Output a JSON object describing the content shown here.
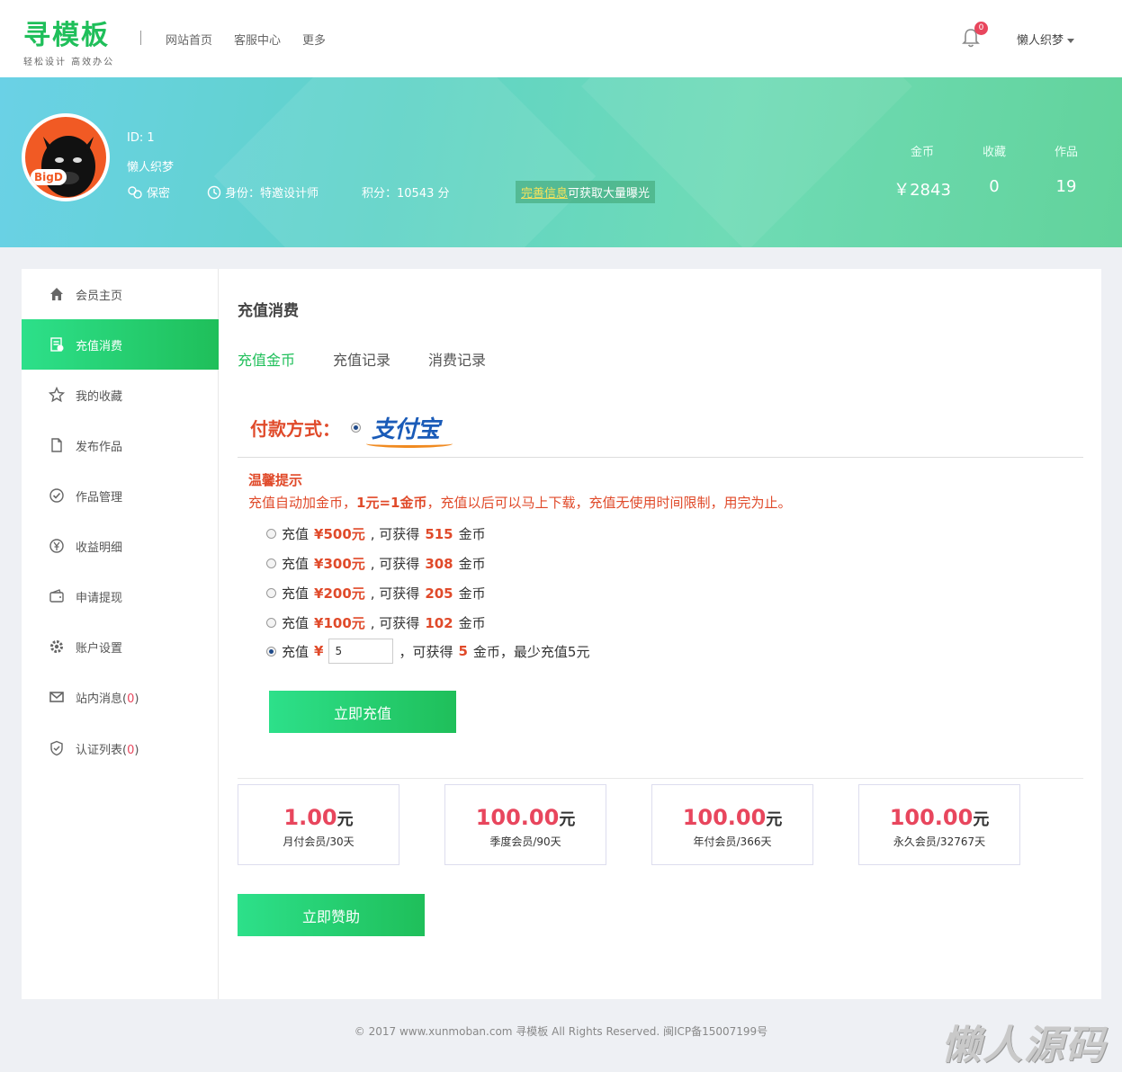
{
  "header": {
    "logo_title": "寻模板",
    "logo_slogan": "轻松设计  高效办公",
    "nav": [
      "网站首页",
      "客服中心",
      "更多"
    ],
    "notification_count": "0",
    "username": "懒人织梦"
  },
  "profile": {
    "avatar_text": "BigD",
    "id_label": "ID: 1",
    "name": "懒人织梦",
    "gender": "保密",
    "identity": "身份：特邀设计师",
    "points": "积分：10543 分",
    "tip_link": "完善信息",
    "tip_text": "可获取大量曝光",
    "stats": [
      {
        "label": "金币",
        "value": "￥2843"
      },
      {
        "label": "收藏",
        "value": "0"
      },
      {
        "label": "作品",
        "value": "19"
      }
    ]
  },
  "sidebar": {
    "items": [
      {
        "label": "会员主页",
        "icon": "home-icon"
      },
      {
        "label": "充值消费",
        "icon": "bill-icon"
      },
      {
        "label": "我的收藏",
        "icon": "star-icon"
      },
      {
        "label": "发布作品",
        "icon": "document-icon"
      },
      {
        "label": "作品管理",
        "icon": "check-circle-icon"
      },
      {
        "label": "收益明细",
        "icon": "yen-icon"
      },
      {
        "label": "申请提现",
        "icon": "wallet-icon"
      },
      {
        "label": "账户设置",
        "icon": "gear-icon"
      },
      {
        "label": "站内消息",
        "icon": "mail-icon",
        "count": "0"
      },
      {
        "label": "认证列表",
        "icon": "shield-icon",
        "count": "0"
      }
    ]
  },
  "content": {
    "title": "充值消费",
    "tabs": [
      "充值金币",
      "充值记录",
      "消费记录"
    ],
    "payment_label": "付款方式：",
    "payment_method": "支付宝",
    "warm_title": "温馨提示",
    "warm_pre": "充值自动加金币，",
    "warm_bold": "1元=1金币",
    "warm_post": "，充值以后可以马上下载，充值无使用时间限制，用完为止。",
    "options": [
      {
        "pre": "充值",
        "amount": "¥500元",
        "mid": ", 可获得",
        "coins": "515",
        "post": "金币"
      },
      {
        "pre": "充值",
        "amount": "¥300元",
        "mid": ", 可获得",
        "coins": "308",
        "post": "金币"
      },
      {
        "pre": "充值",
        "amount": "¥200元",
        "mid": ", 可获得",
        "coins": "205",
        "post": "金币"
      },
      {
        "pre": "充值",
        "amount": "¥100元",
        "mid": ", 可获得",
        "coins": "102",
        "post": "金币"
      }
    ],
    "custom": {
      "pre": "充值",
      "yen": "¥",
      "value": "5",
      "mid": "，可获得",
      "coins": "5",
      "post": "金币，最少充值5元"
    },
    "recharge_button": "立即充值",
    "plans": [
      {
        "price": "1.00",
        "unit": "元",
        "name": "月付会员/30天"
      },
      {
        "price": "100.00",
        "unit": "元",
        "name": "季度会员/90天"
      },
      {
        "price": "100.00",
        "unit": "元",
        "name": "年付会员/366天"
      },
      {
        "price": "100.00",
        "unit": "元",
        "name": "永久会员/32767天"
      }
    ],
    "sponsor_button": "立即赞助"
  },
  "footer": "© 2017 www.xunmoban.com 寻模板 All Rights Reserved. 闽ICP备15007199号",
  "watermark": "懒人源码",
  "colors": {
    "accent": "#1fbf5a",
    "warning": "#e04a2a",
    "price": "#e8465d"
  }
}
